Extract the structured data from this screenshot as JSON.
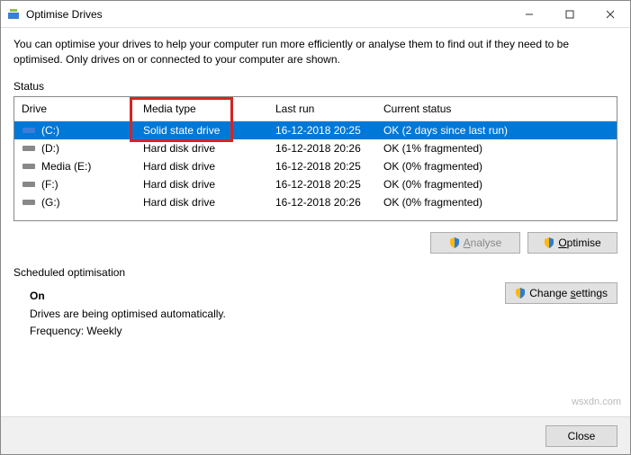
{
  "window": {
    "title": "Optimise Drives"
  },
  "description": "You can optimise your drives to help your computer run more efficiently or analyse them to find out if they need to be optimised. Only drives on or connected to your computer are shown.",
  "status_label": "Status",
  "columns": {
    "drive": "Drive",
    "media": "Media type",
    "last": "Last run",
    "status": "Current status"
  },
  "drives": [
    {
      "name": "(C:)",
      "media": "Solid state drive",
      "last": "16-12-2018 20:25",
      "status": "OK (2 days since last run)",
      "selected": true,
      "icon": "ssd"
    },
    {
      "name": "(D:)",
      "media": "Hard disk drive",
      "last": "16-12-2018 20:26",
      "status": "OK (1% fragmented)",
      "selected": false,
      "icon": "hdd"
    },
    {
      "name": "Media (E:)",
      "media": "Hard disk drive",
      "last": "16-12-2018 20:25",
      "status": "OK (0% fragmented)",
      "selected": false,
      "icon": "hdd"
    },
    {
      "name": "(F:)",
      "media": "Hard disk drive",
      "last": "16-12-2018 20:25",
      "status": "OK (0% fragmented)",
      "selected": false,
      "icon": "hdd"
    },
    {
      "name": "(G:)",
      "media": "Hard disk drive",
      "last": "16-12-2018 20:26",
      "status": "OK (0% fragmented)",
      "selected": false,
      "icon": "hdd"
    }
  ],
  "buttons": {
    "analyse": "Analyse",
    "optimise": "Optimise",
    "change": "Change settings",
    "close": "Close"
  },
  "schedule": {
    "label": "Scheduled optimisation",
    "on": "On",
    "desc": "Drives are being optimised automatically.",
    "freq": "Frequency: Weekly"
  },
  "watermark": "wsxdn.com"
}
